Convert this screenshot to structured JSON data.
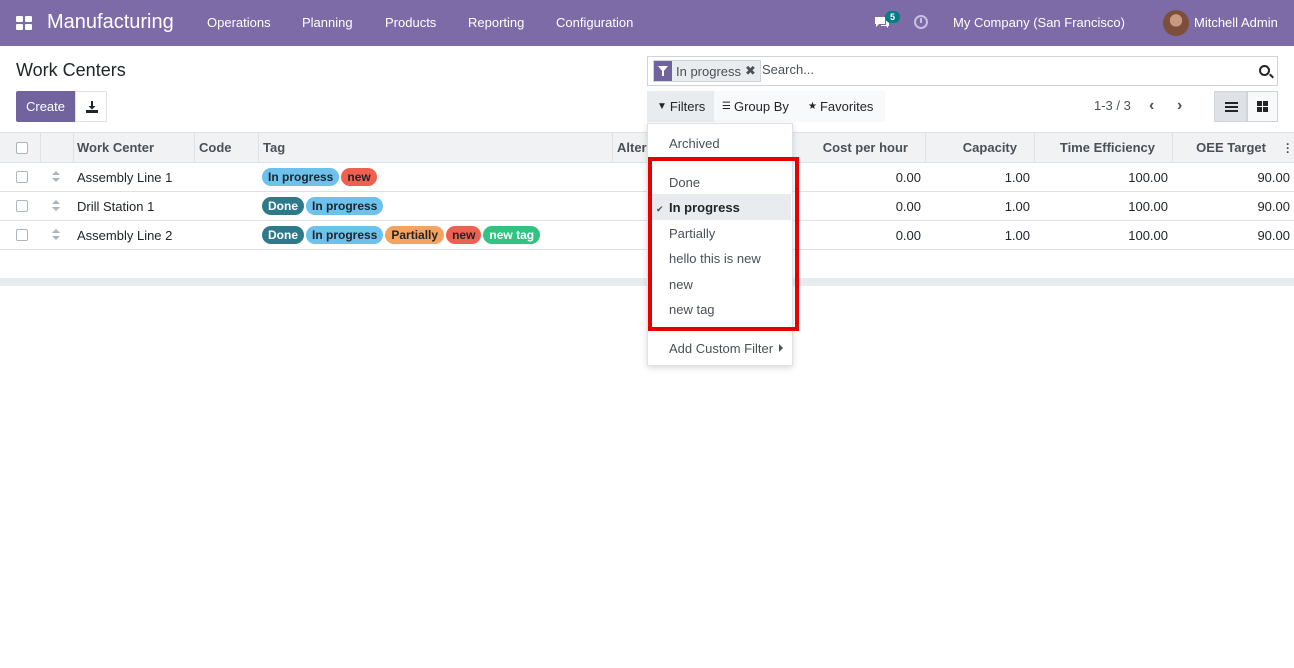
{
  "navbar": {
    "app_name": "Manufacturing",
    "menus": [
      "Operations",
      "Planning",
      "Products",
      "Reporting",
      "Configuration"
    ],
    "messages_count": "5",
    "company": "My Company (San Francisco)",
    "user": "Mitchell Admin"
  },
  "control_panel": {
    "title": "Work Centers",
    "create_label": "Create",
    "facet_label": "In progress",
    "search_placeholder": "Search...",
    "filters_label": "Filters",
    "groupby_label": "Group By",
    "favorites_label": "Favorites",
    "pager": "1-3 / 3"
  },
  "table": {
    "columns": [
      "Work Center",
      "Code",
      "Tag",
      "Alter",
      "Cost per hour",
      "Capacity",
      "Time Efficiency",
      "OEE Target"
    ],
    "rows": [
      {
        "name": "Assembly Line 1",
        "code": "",
        "tags": [
          "In progress",
          "new"
        ],
        "cost": "0.00",
        "capacity": "1.00",
        "efficiency": "100.00",
        "oee": "90.00"
      },
      {
        "name": "Drill Station 1",
        "code": "",
        "tags": [
          "Done",
          "In progress"
        ],
        "cost": "0.00",
        "capacity": "1.00",
        "efficiency": "100.00",
        "oee": "90.00"
      },
      {
        "name": "Assembly Line 2",
        "code": "",
        "tags": [
          "Done",
          "In progress",
          "Partially",
          "new",
          "new tag"
        ],
        "cost": "0.00",
        "capacity": "1.00",
        "efficiency": "100.00",
        "oee": "90.00"
      }
    ]
  },
  "tag_colors": {
    "Done": "#2c7a8a",
    "In progress": "#6cc1ed",
    "new": "#f06050",
    "Partially": "#f4a460",
    "new tag": "#30c381"
  },
  "filters_menu": {
    "archived": "Archived",
    "tag_filters": [
      "Done",
      "In progress",
      "Partially",
      "hello this is new",
      "new",
      "new tag"
    ],
    "selected": "In progress",
    "custom": "Add Custom Filter"
  },
  "colors": {
    "navbar": "#7c6ba6",
    "primary": "#71639e",
    "highlight": "#e60000"
  }
}
